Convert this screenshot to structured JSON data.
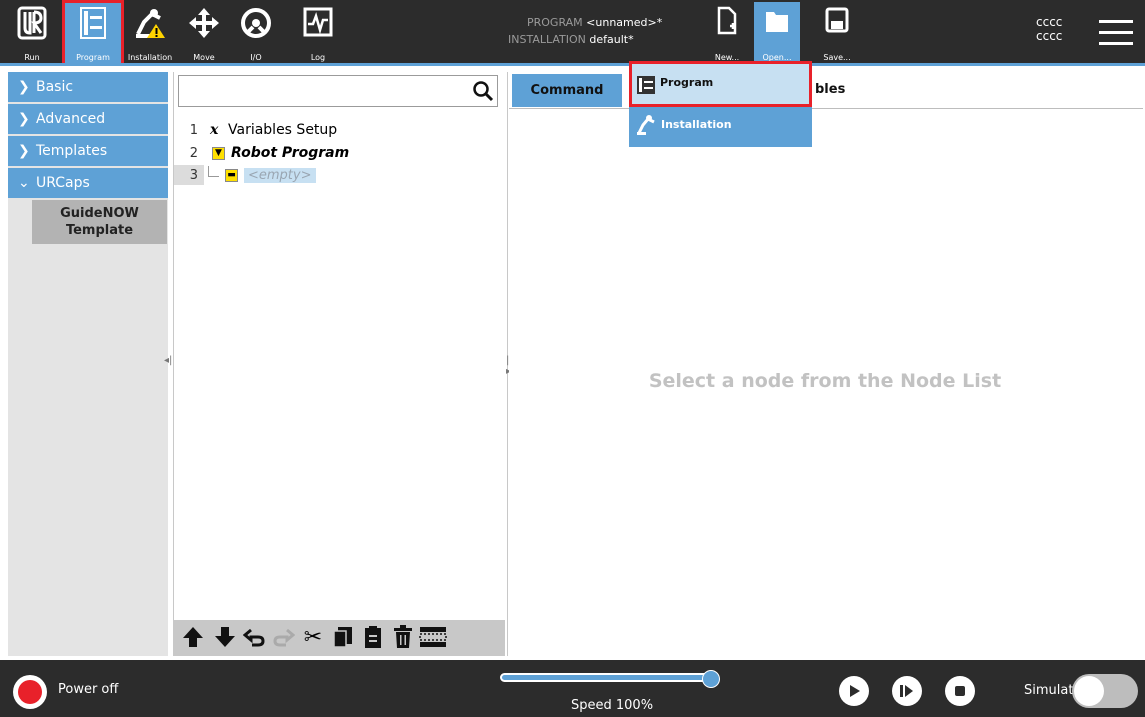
{
  "topnav": {
    "run": "Run",
    "program": "Program",
    "installation": "Installation",
    "move": "Move",
    "io": "I/O",
    "log": "Log"
  },
  "program_info": {
    "program_label": "PROGRAM",
    "program_value": "<unnamed>*",
    "installation_label": "INSTALLATION",
    "installation_value": "default*"
  },
  "file_actions": {
    "new": "New...",
    "open": "Open...",
    "save": "Save..."
  },
  "user": {
    "line1": "cccc",
    "line2": "cccc"
  },
  "sidebar": {
    "items": [
      {
        "label": "Basic",
        "expanded": false
      },
      {
        "label": "Advanced",
        "expanded": false
      },
      {
        "label": "Templates",
        "expanded": false
      },
      {
        "label": "URCaps",
        "expanded": true
      }
    ],
    "urcap_items": [
      "GuideNOW Template"
    ]
  },
  "tree": {
    "rows": [
      {
        "num": "1",
        "label": "Variables Setup"
      },
      {
        "num": "2",
        "label": "Robot Program"
      },
      {
        "num": "3",
        "label": "<empty>"
      }
    ]
  },
  "tabs": {
    "command": "Command",
    "variables_partial": "bles"
  },
  "main": {
    "placeholder": "Select a node from the Node List"
  },
  "open_menu": {
    "program": "Program",
    "installation": "Installation"
  },
  "bottom": {
    "power": "Power off",
    "speed": "Speed 100%",
    "speed_value": 100,
    "simulation": "Simulation",
    "simulation_on": false
  },
  "colors": {
    "accent": "#5ea1d6",
    "highlight": "#e8212a",
    "bar": "#2c2c2c"
  }
}
